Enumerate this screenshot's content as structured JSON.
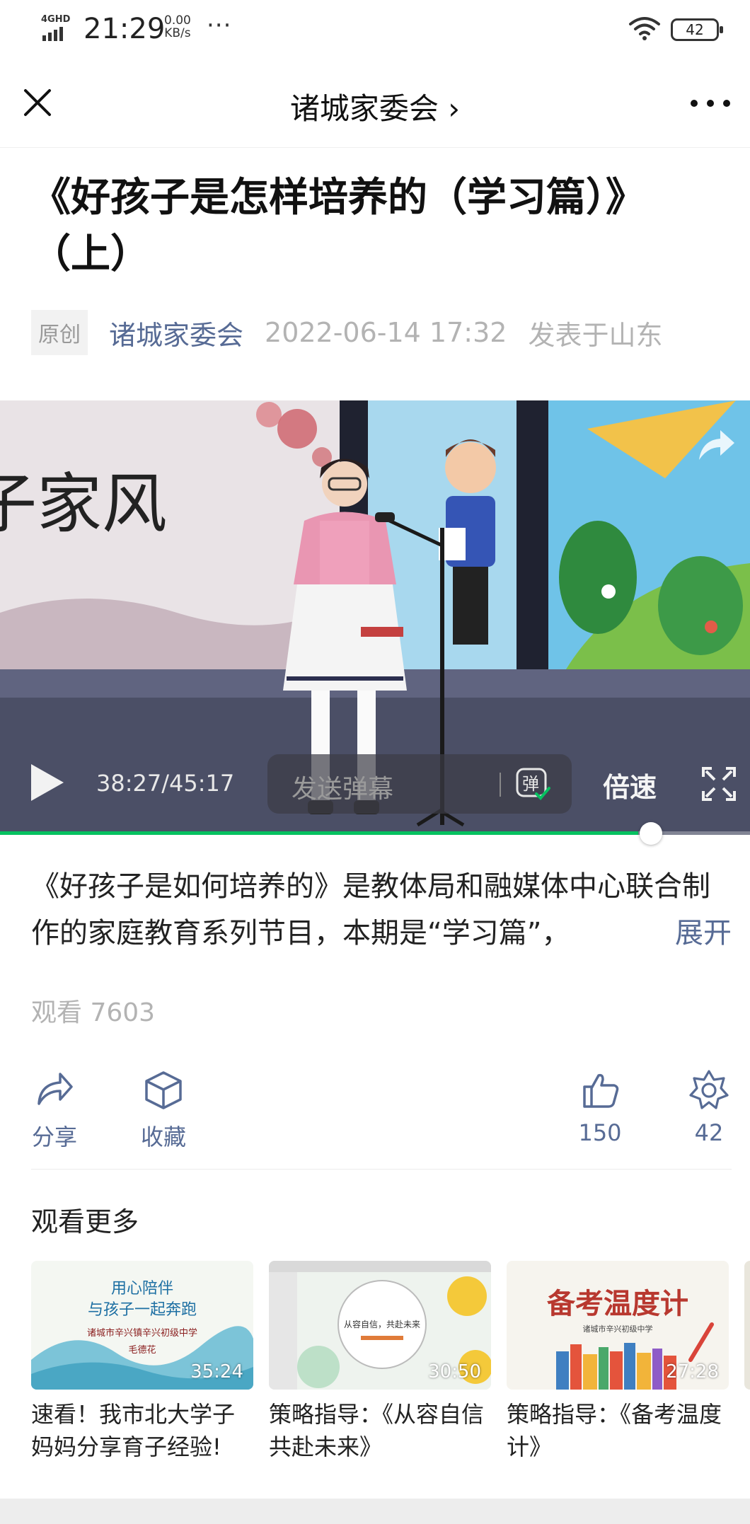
{
  "status_bar": {
    "network": "4GHD",
    "time": "21:29",
    "speed_value": "0.00",
    "speed_unit": "KB/s",
    "battery": "42"
  },
  "nav": {
    "title": "诸城家委会 ›"
  },
  "article": {
    "title": "《好孩子是怎样培养的（学习篇）》（上）",
    "original_tag": "原创",
    "account": "诸城家委会",
    "datetime": "2022-06-14 17:32",
    "location": "发表于山东"
  },
  "video": {
    "banner_text": "子家风",
    "time": "38:27/45:17",
    "danmu_placeholder": "发送弹幕",
    "danmu_icon_text": "弹",
    "speed_label": "倍速",
    "progress": 0.851
  },
  "description": {
    "text": "《好孩子是如何培养的》是教体局和融媒体中心联合制作的家庭教育系列节目，本期是“学习篇”，",
    "expand_label": "展开"
  },
  "views": "观看 7603",
  "actions": {
    "share": "分享",
    "favorite": "收藏",
    "like_count": "150",
    "wow_count": "42"
  },
  "more": {
    "title": "观看更多",
    "items": [
      {
        "thumb_line1": "用心陪伴",
        "thumb_line2": "与孩子一起奔跑",
        "thumb_line3": "诸城市辛兴镇辛兴初级中学",
        "thumb_line4": "毛德花",
        "duration": "35:24",
        "caption": "速看！我市北大学子妈妈分享育子经验!"
      },
      {
        "thumb_text": "从容自信，共赴未来",
        "duration": "30:50",
        "caption": "策略指导：《从容自信 共赴未来》"
      },
      {
        "thumb_title": "备考温度计",
        "thumb_sub": "诸城市辛兴初级中学",
        "duration": "27:28",
        "caption": "策略指导：《备考温度计》"
      }
    ]
  }
}
